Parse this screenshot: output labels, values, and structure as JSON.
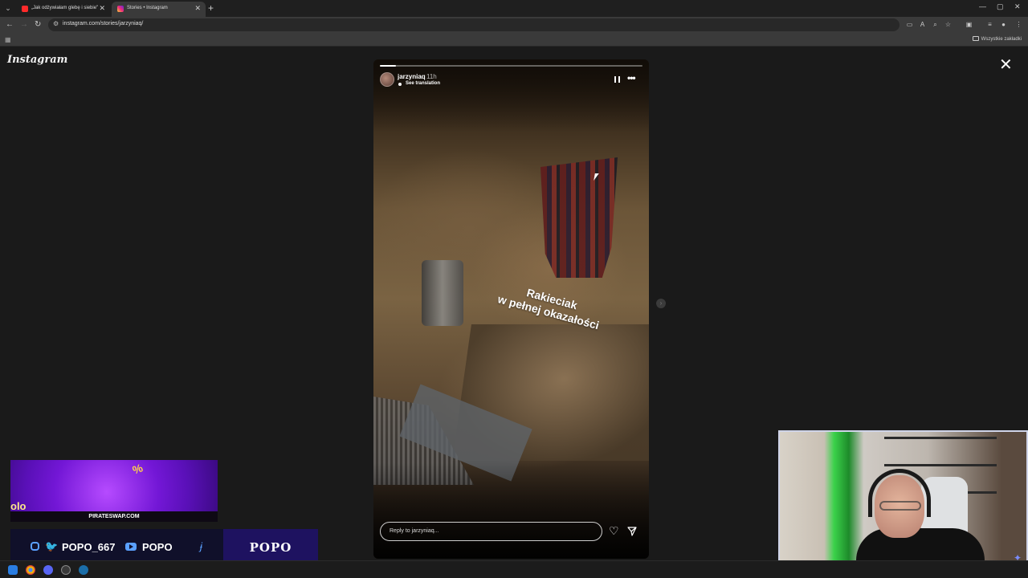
{
  "browser": {
    "tabs": [
      {
        "title": "„Jak odżywiałam glebę i siebie\"",
        "favicon_color": "#ff2a2a",
        "active": false
      },
      {
        "title": "Stories • Instagram",
        "favicon_color": "#d6249f",
        "active": true
      }
    ],
    "new_tab_icon": "plus-icon",
    "url": "instagram.com/stories/jarzyniaq/",
    "bookmarks_all_label": "Wszystkie zakładki"
  },
  "instagram": {
    "logo": "Instagram",
    "story": {
      "username": "jarzyniaq",
      "time": "11h",
      "translation_label": "See translation",
      "caption_line1": "Rakieciak",
      "caption_line2": "w pełnej okazałości",
      "progress_fraction": 0.06,
      "reply_placeholder": "Reply to jarzyniaq..."
    }
  },
  "overlay": {
    "banner_site": "PIRATESWAP.COM",
    "banner_partial_text": "olo",
    "social_handle": "POPO_667",
    "youtube_name": "POPO",
    "brand": "POPO"
  },
  "colors": {
    "accent_blue": "#5aa0ff",
    "brand_bg": "#1e1260",
    "banner_purple": "#7317d6"
  }
}
